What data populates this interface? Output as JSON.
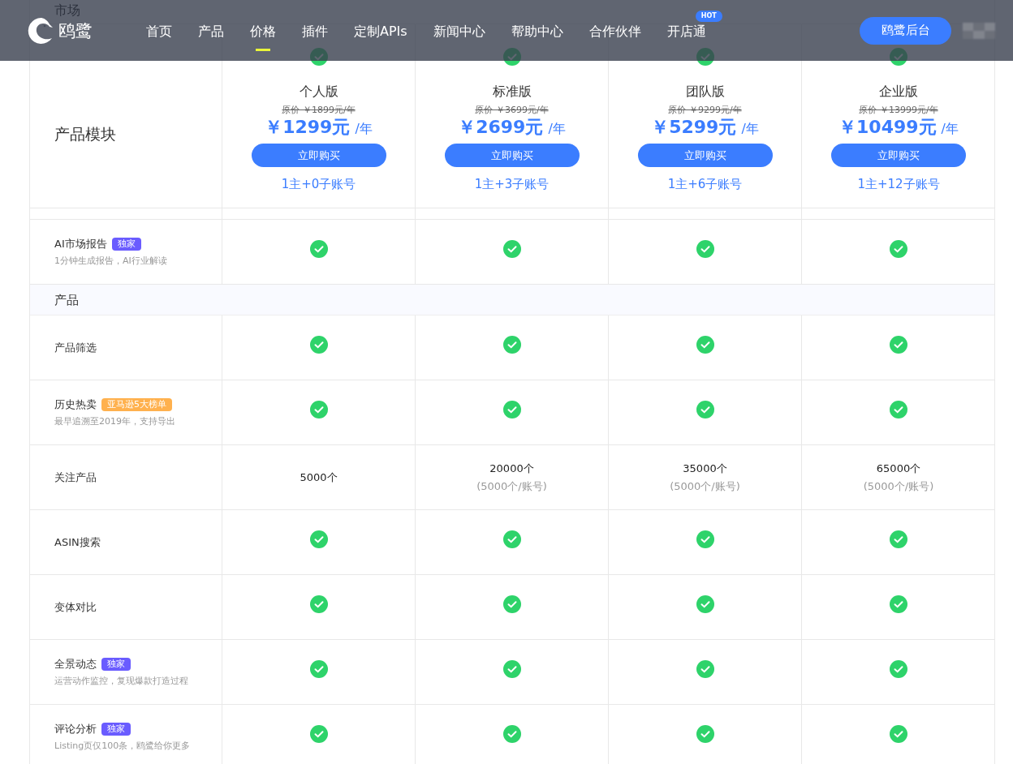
{
  "nav": {
    "brand": "鸥鹭",
    "items": [
      {
        "label": "首页",
        "selected": false
      },
      {
        "label": "产品",
        "selected": false
      },
      {
        "label": "价格",
        "selected": true
      },
      {
        "label": "插件",
        "selected": false
      },
      {
        "label": "定制APIs",
        "selected": false
      },
      {
        "label": "新闻中心",
        "selected": false
      },
      {
        "label": "帮助中心",
        "selected": false
      },
      {
        "label": "合作伙伴",
        "selected": false
      },
      {
        "label": "开店通",
        "selected": false,
        "badge": "HOT"
      }
    ],
    "console_button": "鸥鹭后台"
  },
  "behind_header": {
    "section": "市场",
    "cells": [
      {
        "kind": "check"
      },
      {
        "kind": "check"
      },
      {
        "kind": "check"
      },
      {
        "kind": "check"
      }
    ]
  },
  "pricing": {
    "module_label": "产品模块",
    "plans": [
      {
        "name": "个人版",
        "original": "原价 ￥1899元/年",
        "price": "￥1299元",
        "unit": "/年",
        "buy": "立即购买",
        "accounts": "1主+0子账号"
      },
      {
        "name": "标准版",
        "original": "原价 ￥3699元/年",
        "price": "￥2699元",
        "unit": "/年",
        "buy": "立即购买",
        "accounts": "1主+3子账号"
      },
      {
        "name": "团队版",
        "original": "原价 ￥9299元/年",
        "price": "￥5299元",
        "unit": "/年",
        "buy": "立即购买",
        "accounts": "1主+6子账号"
      },
      {
        "name": "企业版",
        "original": "原价 ￥13999元/年",
        "price": "￥10499元",
        "unit": "/年",
        "buy": "立即购买",
        "accounts": "1主+12子账号"
      }
    ]
  },
  "rows": [
    {
      "kind": "feature",
      "label": "AI市场报告",
      "badge": {
        "text": "独家",
        "color": "#6a5cff"
      },
      "desc": "1分钟生成报告，AI行业解读",
      "cells": [
        {
          "kind": "check"
        },
        {
          "kind": "check"
        },
        {
          "kind": "check"
        },
        {
          "kind": "check"
        }
      ]
    },
    {
      "kind": "section",
      "label": "产品"
    },
    {
      "kind": "feature",
      "label": "产品筛选",
      "cells": [
        {
          "kind": "check"
        },
        {
          "kind": "check"
        },
        {
          "kind": "check"
        },
        {
          "kind": "check"
        }
      ]
    },
    {
      "kind": "feature",
      "label": "历史热卖",
      "badge": {
        "text": "亚马逊5大榜单",
        "color": "#ffb14e"
      },
      "desc": "最早追溯至2019年，支持导出",
      "cells": [
        {
          "kind": "check"
        },
        {
          "kind": "check"
        },
        {
          "kind": "check"
        },
        {
          "kind": "check"
        }
      ]
    },
    {
      "kind": "feature",
      "label": "关注产品",
      "cells": [
        {
          "kind": "count",
          "value": "5000个"
        },
        {
          "kind": "count",
          "value": "20000个",
          "note": "(5000个/账号)"
        },
        {
          "kind": "count",
          "value": "35000个",
          "note": "(5000个/账号)"
        },
        {
          "kind": "count",
          "value": "65000个",
          "note": "(5000个/账号)"
        }
      ]
    },
    {
      "kind": "feature",
      "label": "ASIN搜索",
      "cells": [
        {
          "kind": "check"
        },
        {
          "kind": "check"
        },
        {
          "kind": "check"
        },
        {
          "kind": "check"
        }
      ]
    },
    {
      "kind": "feature",
      "label": "变体对比",
      "cells": [
        {
          "kind": "check"
        },
        {
          "kind": "check"
        },
        {
          "kind": "check"
        },
        {
          "kind": "check"
        }
      ]
    },
    {
      "kind": "feature",
      "label": "全景动态",
      "badge": {
        "text": "独家",
        "color": "#6a5cff"
      },
      "desc": "运营动作监控，复现爆款打造过程",
      "cells": [
        {
          "kind": "check"
        },
        {
          "kind": "check"
        },
        {
          "kind": "check"
        },
        {
          "kind": "check"
        }
      ]
    },
    {
      "kind": "feature",
      "label": "评论分析",
      "badge": {
        "text": "独家",
        "color": "#6a5cff"
      },
      "desc": "Listing页仅100条，鸥鹭给你更多",
      "cells": [
        {
          "kind": "check"
        },
        {
          "kind": "check"
        },
        {
          "kind": "check"
        },
        {
          "kind": "check"
        }
      ]
    }
  ]
}
